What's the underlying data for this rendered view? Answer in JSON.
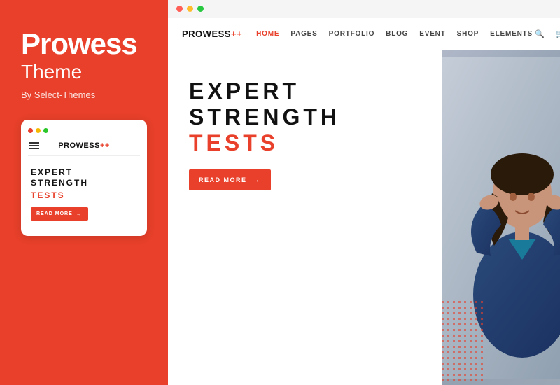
{
  "sidebar": {
    "title": "Prowess",
    "subtitle": "Theme",
    "by_label": "By Select-Themes"
  },
  "mockup": {
    "logo": "PROWESS",
    "logo_plus": "++",
    "hero_line1": "EXPERT",
    "hero_line2": "STRENGTH",
    "hero_line3": "TESTS",
    "btn_label": "READ MORE"
  },
  "browser": {
    "dots": [
      "red",
      "yellow",
      "green"
    ]
  },
  "website": {
    "logo": "PROWESS",
    "logo_plus": "++",
    "nav_links": [
      {
        "label": "HOME",
        "active": true
      },
      {
        "label": "PAGES",
        "active": false
      },
      {
        "label": "PORTFOLIO",
        "active": false
      },
      {
        "label": "BLOG",
        "active": false
      },
      {
        "label": "EVENT",
        "active": false
      },
      {
        "label": "SHOP",
        "active": false
      },
      {
        "label": "ELEMENTS",
        "active": false
      }
    ],
    "hero_line1": "EXPERT",
    "hero_line2": "STRENGTH",
    "hero_line3": "TESTS",
    "btn_label": "READ MORE"
  }
}
